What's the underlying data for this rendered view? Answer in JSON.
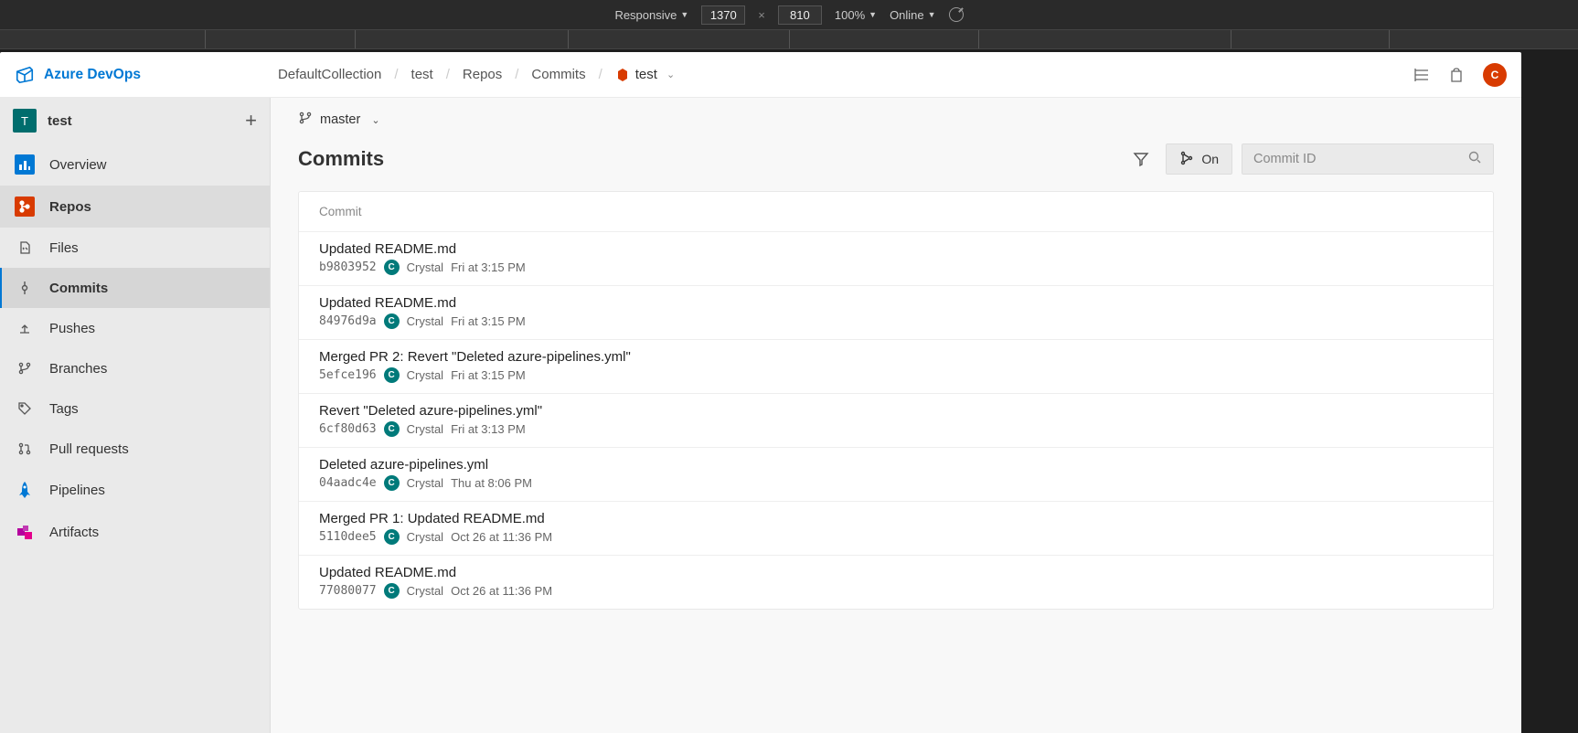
{
  "devtools": {
    "mode": "Responsive",
    "width": "1370",
    "height": "810",
    "zoom": "100%",
    "throttling": "Online"
  },
  "brand": "Azure DevOps",
  "breadcrumb": {
    "collection": "DefaultCollection",
    "project": "test",
    "area": "Repos",
    "page": "Commits",
    "repo": "test"
  },
  "avatar_letter": "C",
  "sidebar": {
    "project_letter": "T",
    "project_name": "test",
    "items": {
      "overview": "Overview",
      "repos": "Repos",
      "files": "Files",
      "commits": "Commits",
      "pushes": "Pushes",
      "branches": "Branches",
      "tags": "Tags",
      "pullrequests": "Pull requests",
      "pipelines": "Pipelines",
      "artifacts": "Artifacts"
    }
  },
  "main": {
    "branch": "master",
    "title": "Commits",
    "graph_toggle": "On",
    "search_placeholder": "Commit ID",
    "list_header": "Commit"
  },
  "commits": [
    {
      "title": "Updated README.md",
      "hash": "b9803952",
      "author": "Crystal",
      "time": "Fri at 3:15 PM",
      "avatar": "C"
    },
    {
      "title": "Updated README.md",
      "hash": "84976d9a",
      "author": "Crystal",
      "time": "Fri at 3:15 PM",
      "avatar": "C"
    },
    {
      "title": "Merged PR 2: Revert \"Deleted azure-pipelines.yml\"",
      "hash": "5efce196",
      "author": "Crystal",
      "time": "Fri at 3:15 PM",
      "avatar": "C"
    },
    {
      "title": "Revert \"Deleted azure-pipelines.yml\"",
      "hash": "6cf80d63",
      "author": "Crystal",
      "time": "Fri at 3:13 PM",
      "avatar": "C"
    },
    {
      "title": "Deleted azure-pipelines.yml",
      "hash": "04aadc4e",
      "author": "Crystal",
      "time": "Thu at 8:06 PM",
      "avatar": "C"
    },
    {
      "title": "Merged PR 1: Updated README.md",
      "hash": "5110dee5",
      "author": "Crystal",
      "time": "Oct 26 at 11:36 PM",
      "avatar": "C"
    },
    {
      "title": "Updated README.md",
      "hash": "77080077",
      "author": "Crystal",
      "time": "Oct 26 at 11:36 PM",
      "avatar": "C"
    }
  ]
}
